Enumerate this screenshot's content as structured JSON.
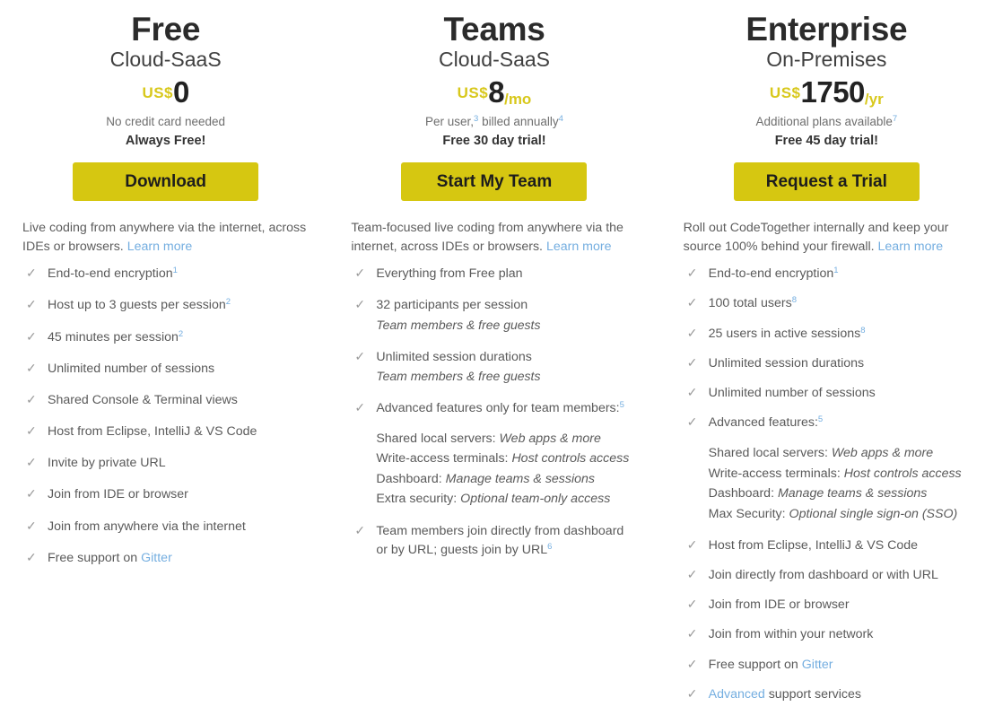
{
  "theme": {
    "accent_yellow": "#d6c711",
    "link_blue": "#74aee0",
    "text_gray": "#5a5a5a",
    "heading_dark": "#2b2b2b"
  },
  "plans": [
    {
      "name": "Free",
      "deployment": "Cloud-SaaS",
      "currency": "US$",
      "amount": "0",
      "period": "",
      "price_note": "No credit card needed",
      "trial_note": "Always Free!",
      "cta_label": "Download",
      "description_text": "Live coding from anywhere via the internet, across IDEs or browsers. ",
      "description_link": "Learn more",
      "features": [
        {
          "text": "End-to-end encryption",
          "sup": "1"
        },
        {
          "text": "Host up to 3 guests per session",
          "sup": "2"
        },
        {
          "text": "45 minutes per session",
          "sup": "2"
        },
        {
          "text": "Unlimited number of sessions",
          "sup": ""
        },
        {
          "text": "Shared Console & Terminal views",
          "sup": ""
        },
        {
          "text": "Host from Eclipse, IntelliJ & VS Code",
          "sup": ""
        },
        {
          "text": "Invite by private URL",
          "sup": ""
        },
        {
          "text": "Join from IDE or browser",
          "sup": ""
        },
        {
          "text": "Join from anywhere via the internet",
          "sup": ""
        },
        {
          "text": "Free support on ",
          "sup": "",
          "link": "Gitter"
        }
      ]
    },
    {
      "name": "Teams",
      "deployment": "Cloud-SaaS",
      "currency": "US$",
      "amount": "8",
      "period": "/mo",
      "price_note_parts": [
        "Per user,",
        "3",
        " billed annually",
        "4"
      ],
      "price_note": "Per user, billed annually",
      "trial_note": "Free 30 day trial!",
      "cta_label": "Start My Team",
      "description_text": "Team-focused live coding from anywhere via the internet, across IDEs or browsers. ",
      "description_link": "Learn more",
      "features": [
        {
          "text": "Everything from Free plan",
          "sup": ""
        },
        {
          "text": "32 participants per session",
          "sup": "",
          "note": "Team members & free guests"
        },
        {
          "text": "Unlimited session durations",
          "sup": "",
          "note": "Team members & free guests"
        },
        {
          "text": "Advanced features only for team members:",
          "sup": "5"
        },
        {
          "text": "Team members join directly from dashboard or by URL; guests join by URL",
          "sup": "6"
        }
      ],
      "advanced_features": [
        {
          "label": "Shared local servers: ",
          "value": "Web apps & more"
        },
        {
          "label": "Write-access terminals: ",
          "value": "Host controls access"
        },
        {
          "label": "Dashboard: ",
          "value": "Manage teams & sessions"
        },
        {
          "label": "Extra security: ",
          "value": "Optional team-only access"
        }
      ]
    },
    {
      "name": "Enterprise",
      "deployment": "On-Premises",
      "currency": "US$",
      "amount": "1750",
      "period": "/yr",
      "price_note": "Additional plans available",
      "price_note_sup": "7",
      "trial_note": "Free 45 day trial!",
      "cta_label": "Request a Trial",
      "description_text": "Roll out CodeTogether internally and keep your source 100% behind your firewall. ",
      "description_link": "Learn more",
      "features": [
        {
          "text": "End-to-end encryption",
          "sup": "1"
        },
        {
          "text": "100 total users",
          "sup": "8"
        },
        {
          "text": "25 users in active sessions",
          "sup": "8"
        },
        {
          "text": "Unlimited session durations",
          "sup": ""
        },
        {
          "text": "Unlimited number of sessions",
          "sup": ""
        },
        {
          "text": "Advanced features:",
          "sup": "5"
        },
        {
          "text": "Host from Eclipse, IntelliJ & VS Code",
          "sup": ""
        },
        {
          "text": "Join directly from dashboard or with URL",
          "sup": ""
        },
        {
          "text": "Join from IDE or browser",
          "sup": ""
        },
        {
          "text": "Join from within your network",
          "sup": ""
        },
        {
          "text": "Free support on ",
          "sup": "",
          "link": "Gitter"
        },
        {
          "text": " support services",
          "sup": "",
          "link_first": "Advanced"
        }
      ],
      "advanced_features": [
        {
          "label": "Shared local servers: ",
          "value": "Web apps & more"
        },
        {
          "label": "Write-access terminals: ",
          "value": "Host controls access"
        },
        {
          "label": "Dashboard: ",
          "value": "Manage teams & sessions"
        },
        {
          "label": "Max Security: ",
          "value": "Optional single sign-on (SSO)"
        }
      ]
    }
  ],
  "icons": {
    "check": "✓"
  }
}
